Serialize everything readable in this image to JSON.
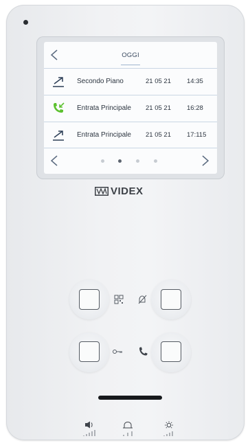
{
  "screen": {
    "title": "OGGI",
    "rows": [
      {
        "icon": "outgoing-call-icon",
        "name": "Secondo Piano",
        "date": "21 05 21",
        "time": "14:35"
      },
      {
        "icon": "incoming-call-icon",
        "name": "Entrata Principale",
        "date": "21 05 21",
        "time": "16:28"
      },
      {
        "icon": "outgoing-call-icon",
        "name": "Entrata Principale",
        "date": "21 05 21",
        "time": "17:115"
      }
    ],
    "pager": {
      "pages": 4,
      "current": 2
    }
  },
  "brand": {
    "name": "VIDEX"
  },
  "controls": {
    "top_left": "button",
    "top_right": "button",
    "bottom_left": "button",
    "bottom_right": "button",
    "icons": [
      "grid-icon",
      "mute-icon",
      "key-icon",
      "phone-icon"
    ]
  },
  "status_icons": [
    "volume-icon",
    "bell-icon",
    "brightness-icon"
  ],
  "colors": {
    "accent_green": "#5cc12f",
    "screen_text": "#2c3540",
    "divider": "#c9d6e4"
  }
}
